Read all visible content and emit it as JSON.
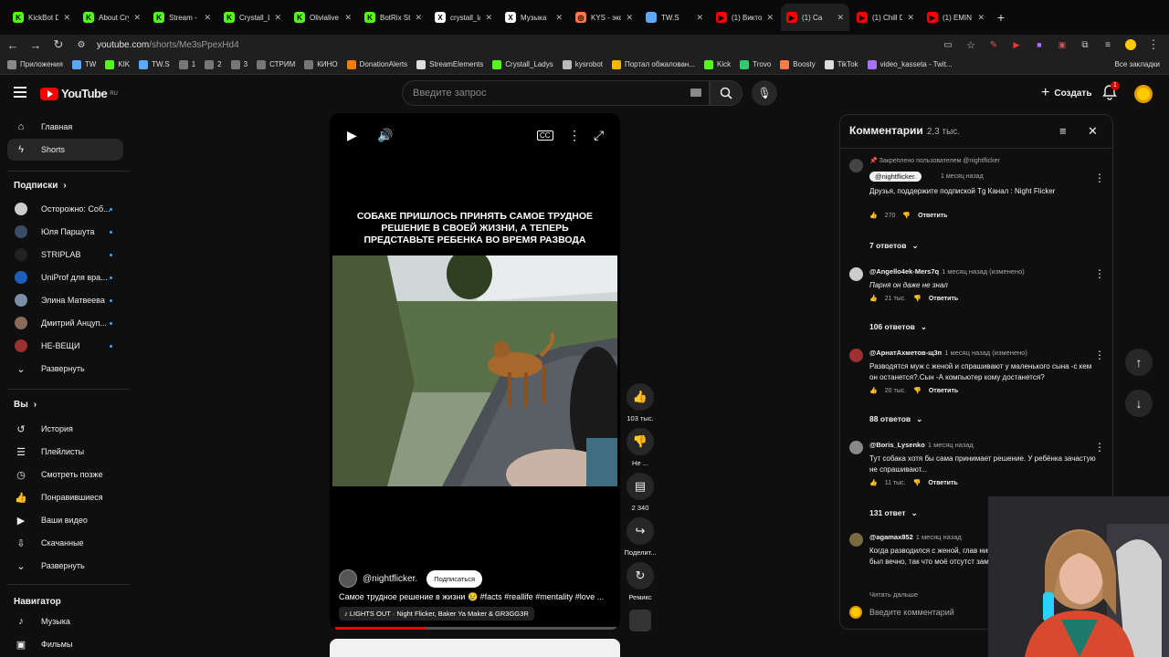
{
  "browser": {
    "tabs": [
      {
        "title": "KickBot D",
        "fav": "K",
        "color": "#53fc18"
      },
      {
        "title": "About Cry",
        "fav": "K",
        "color": "#53fc18"
      },
      {
        "title": "Stream - K",
        "fav": "K",
        "color": "#53fc18"
      },
      {
        "title": "Crystall_La",
        "fav": "K",
        "color": "#53fc18"
      },
      {
        "title": "Olivialive",
        "fav": "K",
        "color": "#53fc18"
      },
      {
        "title": "BotRix Stre",
        "fav": "K",
        "color": "#53fc18"
      },
      {
        "title": "crystall_la",
        "fav": "X",
        "color": "#ffffff"
      },
      {
        "title": "Музыка",
        "fav": "X",
        "color": "#ffffff"
      },
      {
        "title": "KYS - экс",
        "fav": "◎",
        "color": "#ff7a45"
      },
      {
        "title": "TW.S",
        "fav": "",
        "color": "#5aa8ff"
      },
      {
        "title": "(1) Викто",
        "fav": "▶",
        "color": "#ff0000"
      },
      {
        "title": "(1) Са",
        "fav": "▶",
        "color": "#ff0000"
      },
      {
        "title": "(1) Chill D",
        "fav": "▶",
        "color": "#ff0000"
      },
      {
        "title": "(1) EMIN",
        "fav": "▶",
        "color": "#ff0000"
      }
    ],
    "url_host": "youtube.com",
    "url_path": "/shorts/Me3sPpexHd4",
    "bookmarks": [
      "Приложения",
      "TW",
      "KIK",
      "TW.S",
      "1",
      "2",
      "3",
      "СТРИМ",
      "КИНО",
      "DonationAlerts",
      "StreamElements",
      "Crystall_Ladys",
      "kysrobot",
      "Портал обжалован...",
      "Kick",
      "Trovo",
      "Boosty",
      "TikTok",
      "video_kasseta - Twit..."
    ],
    "all_bookmarks": "Все закладки"
  },
  "masthead": {
    "logo_text": "YouTube",
    "logo_region": "RU",
    "search_placeholder": "Введите запрос",
    "create_label": "Создать",
    "notif_count": "1"
  },
  "sidebar": {
    "main": [
      {
        "label": "Главная",
        "icon": "home-icon"
      },
      {
        "label": "Shorts",
        "icon": "shorts-icon"
      }
    ],
    "subs_title": "Подписки",
    "subs": [
      {
        "label": "Осторожно: Соб...",
        "color": "#ccc"
      },
      {
        "label": "Юля Паршута",
        "color": "#3a4d66"
      },
      {
        "label": "STRIPLAB",
        "color": "#222"
      },
      {
        "label": "UniProf для вра...",
        "color": "#1d5fb8"
      },
      {
        "label": "Элина Матвеева",
        "color": "#7a8ea8"
      },
      {
        "label": "Дмитрий Анцуп...",
        "color": "#8a6a5a"
      },
      {
        "label": "НЕ-ВЕЩИ",
        "color": "#9a3030"
      }
    ],
    "expand_label": "Развернуть",
    "you_title": "Вы",
    "you": [
      {
        "label": "История",
        "icon": "history-icon"
      },
      {
        "label": "Плейлисты",
        "icon": "playlists-icon"
      },
      {
        "label": "Смотреть позже",
        "icon": "watch-later-icon"
      },
      {
        "label": "Понравившиеся",
        "icon": "like-icon"
      },
      {
        "label": "Ваши видео",
        "icon": "your-videos-icon"
      },
      {
        "label": "Скачанные",
        "icon": "downloads-icon"
      },
      {
        "label": "Развернуть",
        "icon": "chevron-down-icon"
      }
    ],
    "nav_title": "Навигатор",
    "nav": [
      {
        "label": "Музыка",
        "icon": "music-icon"
      },
      {
        "label": "Фильмы",
        "icon": "movies-icon"
      }
    ]
  },
  "short": {
    "caption": "СОБАКЕ ПРИШЛОСЬ ПРИНЯТЬ САМОЕ ТРУДНОЕ РЕШЕНИЕ В СВОЕЙ ЖИЗНИ, А ТЕПЕРЬ ПРЕДСТАВЬТЕ РЕБЕНКА ВО ВРЕМЯ РАЗВОДА",
    "channel": "@nightflicker.",
    "subscribe_label": "Подписаться",
    "title": "Самое трудное решение в жизни 😢 #facts #reallife #mentality #love ...",
    "music": "LIGHTS OUT · Night Flicker, Baker Ya Maker & GR3GG3R",
    "progress": 0.32
  },
  "actions": {
    "likes": "103 тыс.",
    "dislike": "Не ...",
    "comments": "2 340",
    "share": "Поделит...",
    "remix": "Ремикс"
  },
  "comments_panel": {
    "title": "Комментарии",
    "count": "2,3 тыс.",
    "pinned_label": "Закреплено пользователем @nightflicker",
    "input_placeholder": "Введите комментарий",
    "items": [
      {
        "author": "@nightflicker.",
        "time": "1 месяц назад",
        "text": "Друзья, поддержите подпиской  Tg Канал :         Night Flicker",
        "likes": "270",
        "reply": "Ответить",
        "replies": "7 ответов"
      },
      {
        "author": "@Angello4ek-Mers7q",
        "time": "1 месяц назад (изменено)",
        "text": "Парня он даже не знал",
        "likes": "21 тыс.",
        "reply": "Ответить",
        "replies": "106 ответов"
      },
      {
        "author": "@АрнатАхметов-щ3п",
        "time": "1 месяц назад (изменено)",
        "text": "Разводятся муж с женой и спрашивают у маленького сына -с кем он останется?.Сын -А компьютер кому достанется?",
        "likes": "20 тыс.",
        "reply": "Ответить",
        "replies": "88 ответов"
      },
      {
        "author": "@Boris_Lysenko",
        "time": "1 месяц назад",
        "text": "Тут собака хотя бы сама принимает решение. У ребёнка зачастую не спрашивают...",
        "likes": "11 тыс.",
        "reply": "Ответить",
        "replies": "131 ответ"
      },
      {
        "author": "@agamax852",
        "time": "1 месяц назад",
        "text": "Когда разводился с женой, глав никак не должно отображаться был вечно, так что моё отсутст заметным. Но жена, бывшая уж",
        "more": "Читать дальше"
      }
    ]
  }
}
